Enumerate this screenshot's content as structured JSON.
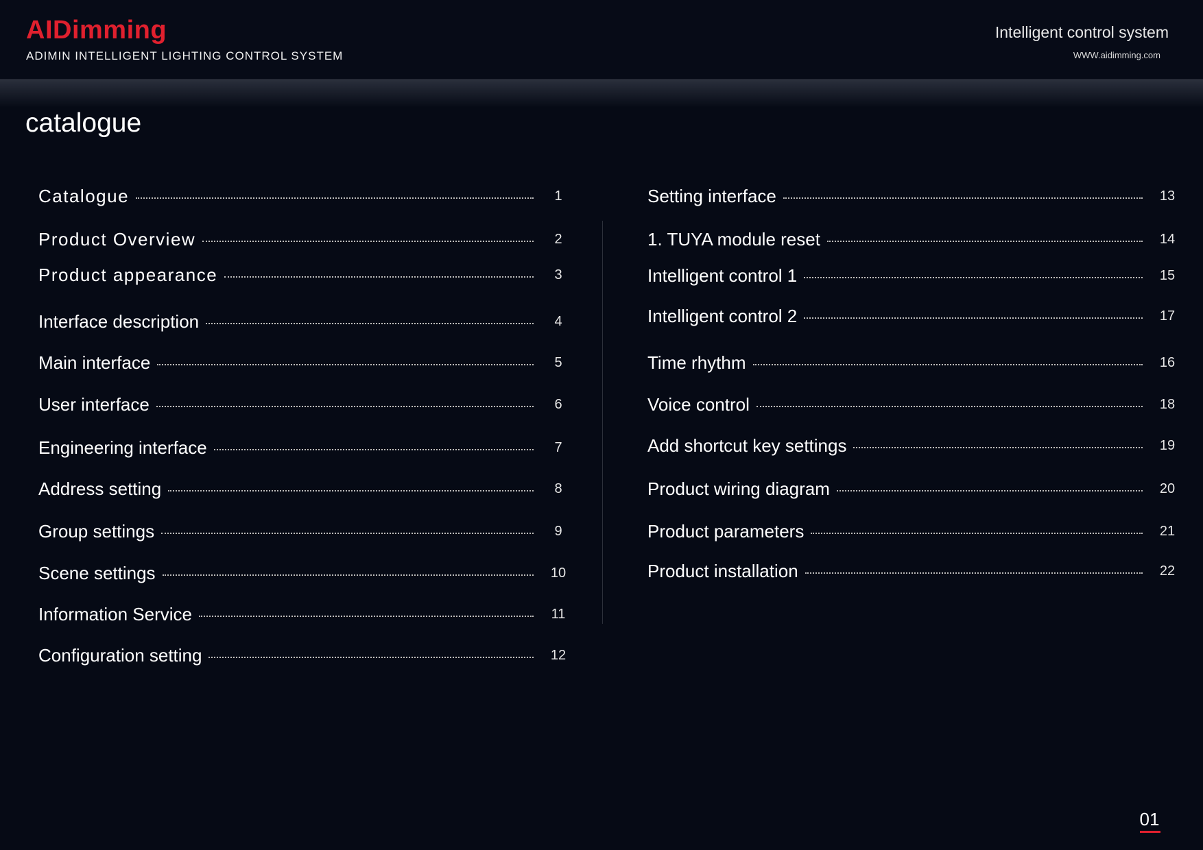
{
  "header": {
    "logo": "AIDimming",
    "subtitle": "ADIMIN INTELLIGENT LIGHTING CONTROL SYSTEM",
    "system_title": "Intelligent control system",
    "website": "WWW.aidimming.com"
  },
  "heading": "catalogue",
  "toc_left": [
    {
      "label": "Catalogue",
      "page": "1"
    },
    {
      "label": "Product Overview",
      "page": "2"
    },
    {
      "label": "Product appearance",
      "page": "3"
    },
    {
      "label": "Interface description",
      "page": "4"
    },
    {
      "label": "Main interface",
      "page": "5"
    },
    {
      "label": "User interface",
      "page": "6"
    },
    {
      "label": "Engineering interface",
      "page": "7"
    },
    {
      "label": "Address setting",
      "page": "8"
    },
    {
      "label": "Group settings",
      "page": "9"
    },
    {
      "label": "Scene settings",
      "page": "10"
    },
    {
      "label": "Information Service",
      "page": "11"
    },
    {
      "label": "Configuration setting",
      "page": "12"
    }
  ],
  "toc_right": [
    {
      "label": "Setting interface",
      "page": "13"
    },
    {
      "label": "1. TUYA module reset",
      "page": "14"
    },
    {
      "label": "Intelligent control 1",
      "page": "15"
    },
    {
      "label": "Intelligent control 2",
      "page": "17"
    },
    {
      "label": "Time rhythm",
      "page": "16"
    },
    {
      "label": "Voice control",
      "page": "18"
    },
    {
      "label": "Add shortcut key settings",
      "page": "19"
    },
    {
      "label": "Product wiring diagram",
      "page": "20"
    },
    {
      "label": "Product parameters",
      "page": "21"
    },
    {
      "label": "Product installation",
      "page": "22"
    }
  ],
  "footer": {
    "page_number": "01",
    "accent_color": "#e0202e"
  }
}
